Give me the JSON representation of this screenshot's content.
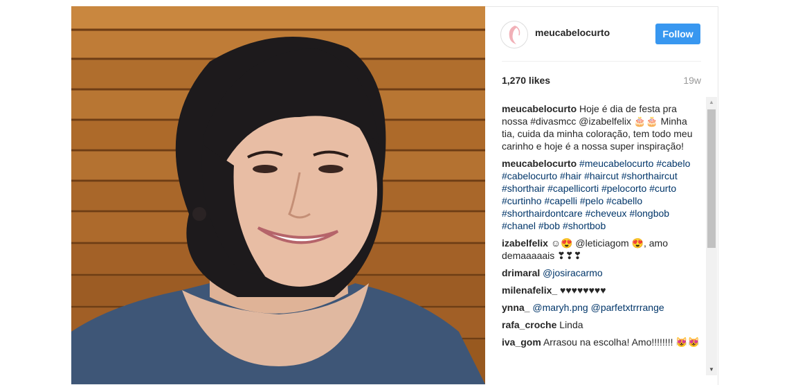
{
  "post": {
    "username": "meucabelocurto",
    "follow_label": "Follow",
    "likes": "1,270 likes",
    "age": "19w"
  },
  "comments": [
    {
      "user": "meucabelocurto",
      "text": "Hoje é dia de festa pra nossa #divasmcc @izabelfelix 🎂🎂 Minha tia, cuida da minha coloração, tem todo meu carinho e hoje é a nossa super inspiração!"
    },
    {
      "user": "meucabelocurto",
      "text": "#meucabelocurto #cabelo #cabelocurto #hair #haircut #shorthaircut #shorthair #capellicorti #pelocorto #curto #curtinho #capelli #pelo #cabello #shorthairdontcare #cheveux #longbob #chanel #bob #shortbob"
    },
    {
      "user": "izabelfelix",
      "text": "☺😍 @leticiagom 😍, amo demaaaaais ❣❣❣"
    },
    {
      "user": "drimaral",
      "text": "@josiracarmo"
    },
    {
      "user": "milenafelix_",
      "text": "♥♥♥♥♥♥♥♥"
    },
    {
      "user": "ynna_",
      "text": "@maryh.png @parfetxtrrrange"
    },
    {
      "user": "rafa_croche",
      "text": "Linda"
    },
    {
      "user": "iva_gom",
      "text": "Arrasou na escolha! Amo!!!!!!!! 😻😻"
    }
  ],
  "icons": {
    "avatar": "hair-silhouette-logo",
    "scroll_up": "arrow-up-icon",
    "scroll_down": "arrow-down-icon"
  },
  "colors": {
    "follow_bg": "#3897f0",
    "tag": "#003569",
    "muted": "#999999"
  }
}
